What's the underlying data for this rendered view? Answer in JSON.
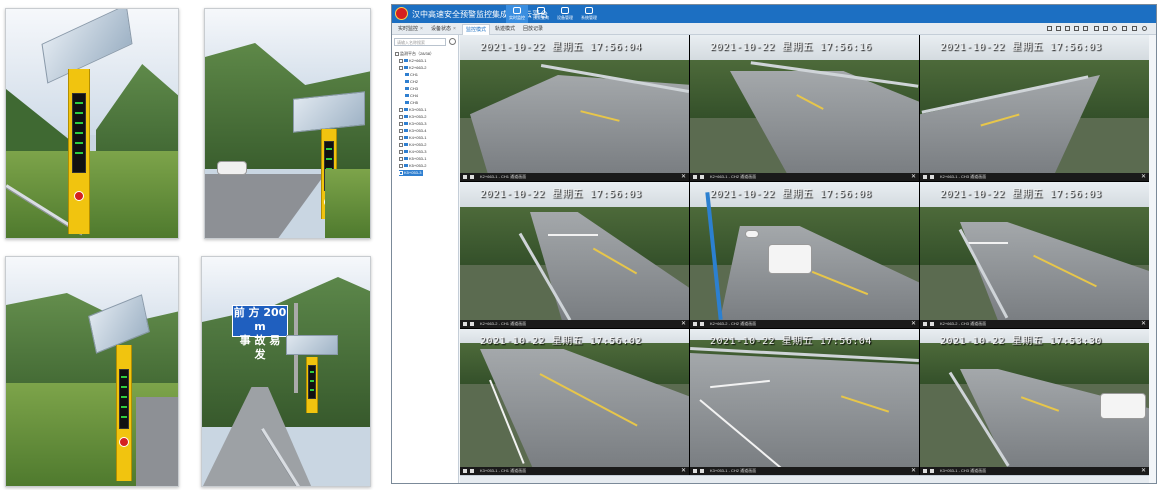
{
  "app": {
    "title": "汉中高速安全预警监控集成指挥云平台",
    "colors": {
      "brand_blue": "#1c6fc2",
      "accent_blue": "#2f7fd0",
      "logo_red": "#d42020"
    },
    "nav": [
      {
        "icon": "monitor-icon",
        "label": "实时监控"
      },
      {
        "icon": "warning-icon",
        "label": "预警查询"
      },
      {
        "icon": "device-icon",
        "label": "设备管理"
      },
      {
        "icon": "settings-icon",
        "label": "系统管理"
      }
    ]
  },
  "tabs": [
    {
      "label": "实时监控",
      "closable": true
    },
    {
      "label": "设备状态",
      "closable": true
    },
    {
      "label": "监控模式",
      "active": true
    },
    {
      "label": "轨迹模式"
    },
    {
      "label": "回放记录"
    }
  ],
  "sidebar": {
    "search_placeholder": "请输入名称搜索",
    "tree": [
      {
        "label": "监测平台（28/38）"
      },
      {
        "label": "K2+663-1"
      },
      {
        "label": "K2+663-2"
      },
      {
        "label": "CH1"
      },
      {
        "label": "CH2"
      },
      {
        "label": "CH3"
      },
      {
        "label": "CH4"
      },
      {
        "label": "CH5"
      },
      {
        "label": "K3+053-1"
      },
      {
        "label": "K3+053-2"
      },
      {
        "label": "K3+053-3"
      },
      {
        "label": "K3+053-4"
      },
      {
        "label": "K4+053-1"
      },
      {
        "label": "K4+053-2"
      },
      {
        "label": "K4+053-3"
      },
      {
        "label": "K5+053-1"
      },
      {
        "label": "K5+053-2"
      },
      {
        "label": "K5+053-3"
      }
    ]
  },
  "cameras": [
    {
      "osd": "2021-10-22 星期五 17:56:04",
      "label": "K2+663-1 - CH1 通道画面"
    },
    {
      "osd": "2021-10-22 星期五 17:56:16",
      "label": "K2+663-1 - CH2 通道画面"
    },
    {
      "osd": "2021-10-22 星期五 17:56:03",
      "label": "K2+663-1 - CH3 通道画面"
    },
    {
      "osd": "2021-10-22 星期五 17:56:03",
      "label": "K2+663-2 - CH1 通道画面"
    },
    {
      "osd": "2021-10-22 星期五 17:56:08",
      "label": "K2+663-2 - CH2 通道画面"
    },
    {
      "osd": "2021-10-22 星期五 17:56:03",
      "label": "K2+663-2 - CH3 通道画面"
    },
    {
      "osd": "2021-10-22 星期五 17:56:02",
      "label": "K3+053-1 - CH1 通道画面"
    },
    {
      "osd": "2021-10-22 星期五 17:56:04",
      "label": "K3+053-1 - CH2 通道画面"
    },
    {
      "osd": "2021-10-22 星期五 17:53:30",
      "label": "K3+053-1 - CH3 通道画面"
    }
  ],
  "photos": {
    "sign_line1": "前 方 200 m",
    "sign_line2": "事 故 易 发"
  }
}
